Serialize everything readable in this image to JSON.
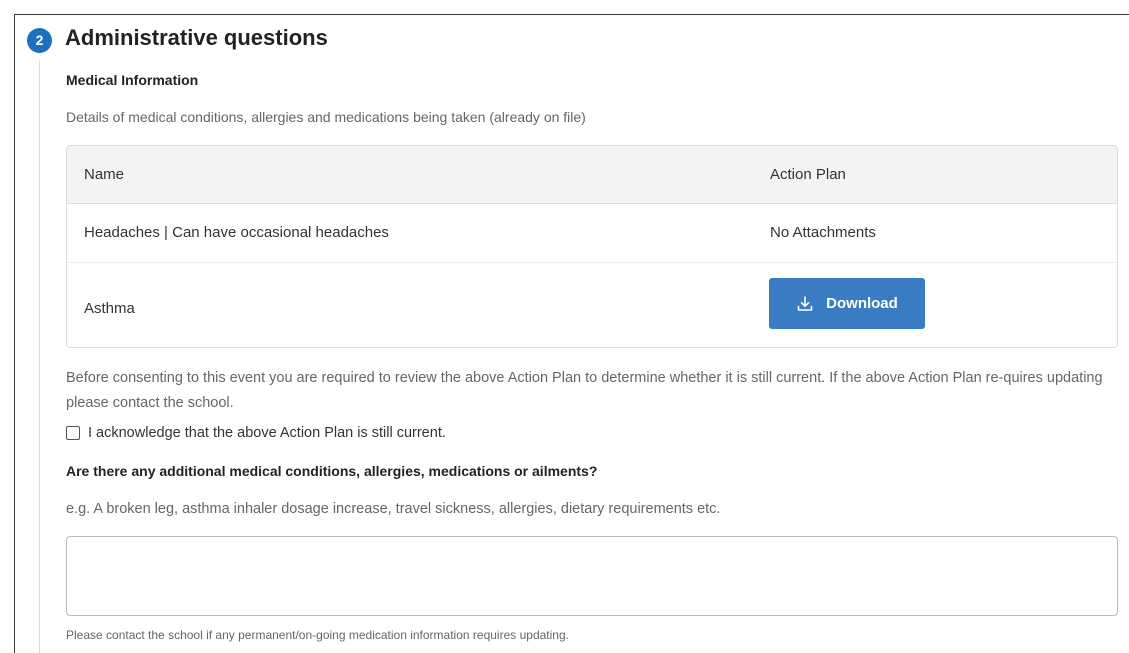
{
  "section": {
    "step_number": "2",
    "title": "Administrative questions"
  },
  "medical_info": {
    "title": "Medical Information",
    "description": "Details of medical conditions, allergies and medications being taken (already on file)",
    "table": {
      "headers": [
        "Name",
        "Action Plan"
      ],
      "rows": [
        {
          "name": "Headaches | Can have occasional headaches",
          "action_plan": "No Attachments"
        },
        {
          "name": "Asthma",
          "action_plan": "Download"
        }
      ]
    },
    "download_icon": "download-icon",
    "review_note": "Before consenting to this event you are required to review the above Action Plan to determine whether it is still current. If the above Action Plan re-quires updating please contact the school.",
    "acknowledge": {
      "label": "I acknowledge that the above Action Plan is still current.",
      "checked": false
    }
  },
  "additional": {
    "question": "Are there any additional medical conditions, allergies, medications or ailments?",
    "hint": "e.g. A broken leg, asthma inhaler dosage increase, travel sickness, allergies, dietary requirements etc.",
    "value": "",
    "footer_note": "Please contact the school if any permanent/on-going medication information requires updating."
  },
  "colors": {
    "accent": "#3a7cc2",
    "badge": "#1f6fc0",
    "header_bg": "#f3f3f3"
  }
}
